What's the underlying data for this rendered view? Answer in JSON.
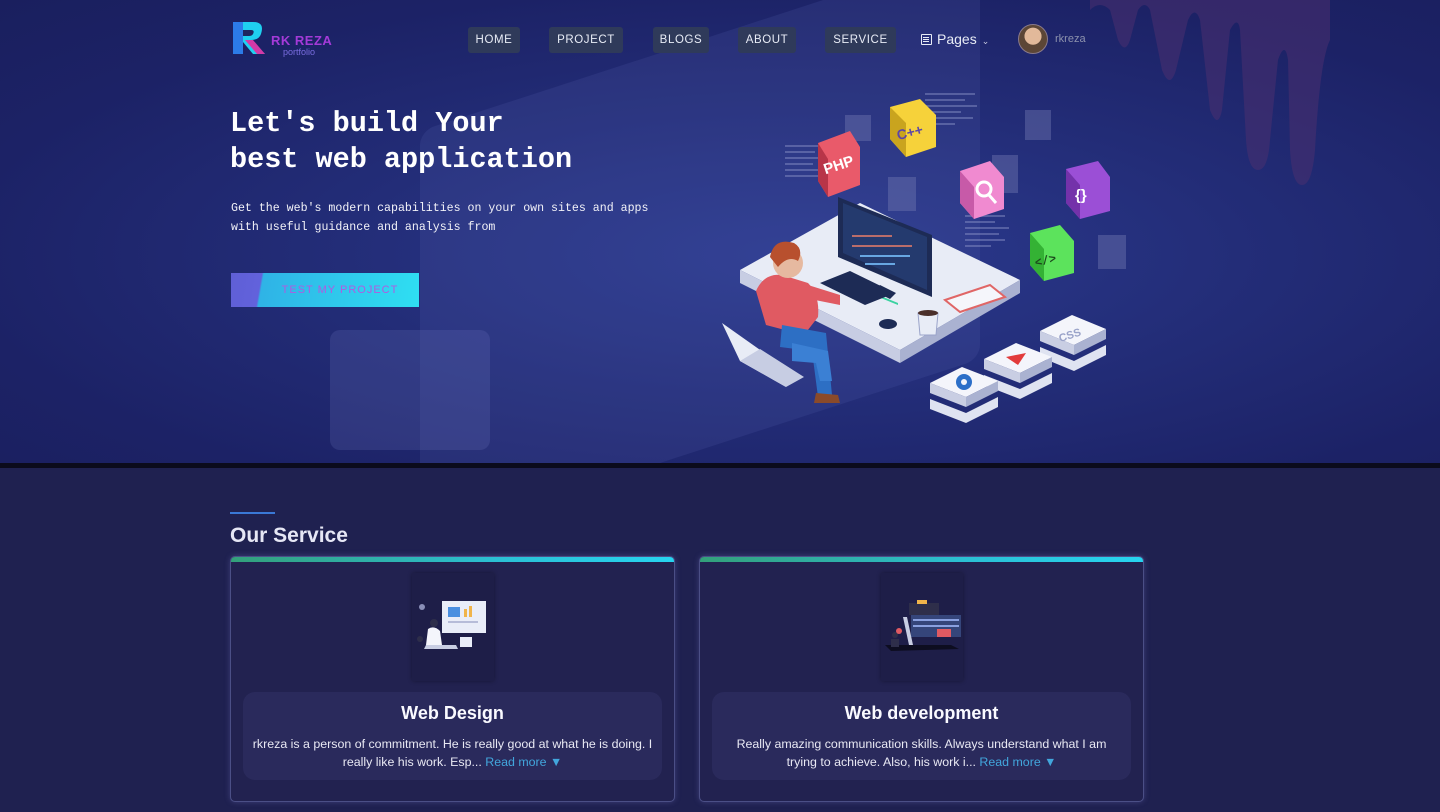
{
  "brand": {
    "name": "RK REZA",
    "sub": "portfolio"
  },
  "nav": {
    "items": [
      "HOME",
      "PROJECT",
      "BLOGS",
      "ABOUT",
      "SERVICE"
    ],
    "pages_label": "Pages",
    "username": "rkreza"
  },
  "hero": {
    "headline_line1": "Let's build Your",
    "headline_line2": "best web application",
    "subtext": "Get the web's modern capabilities on your own sites and apps with useful guidance and analysis from",
    "cta": "TEST MY PROJECT",
    "badges": [
      "PHP",
      "C++",
      "{}",
      "</>",
      "CSS"
    ]
  },
  "services": {
    "title": "Our Service",
    "cards": [
      {
        "heading": "Web Design",
        "desc": "rkreza is a person of commitment. He is really good at what he is doing. I really like his work. Esp...",
        "read_more": "Read more ▼"
      },
      {
        "heading": "Web development",
        "desc": "Really amazing communication skills. Always understand what I am trying to achieve. Also, his work i...",
        "read_more": "Read more ▼"
      }
    ]
  },
  "colors": {
    "accent_cyan": "#2fdff2",
    "accent_purple": "#b05be0",
    "link": "#42a6dc",
    "bg_dark": "#1f2150"
  }
}
